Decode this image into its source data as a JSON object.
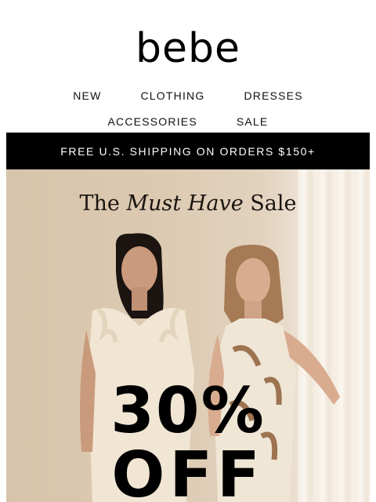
{
  "brand": {
    "logo_text": "bebe"
  },
  "nav": {
    "row1": [
      "NEW",
      "CLOTHING",
      "DRESSES"
    ],
    "row2": [
      "ACCESSORIES",
      "SALE"
    ]
  },
  "banner": {
    "text": "FREE U.S. SHIPPING ON ORDERS $150+"
  },
  "hero": {
    "headline_prefix": "The",
    "headline_italic": "Must Have",
    "headline_suffix": "Sale",
    "offer_percent": "30%",
    "offer_word": "OFF"
  },
  "colors": {
    "banner_bg": "#000000",
    "banner_text": "#ffffff",
    "hero_bg": "#d8c4ab"
  }
}
